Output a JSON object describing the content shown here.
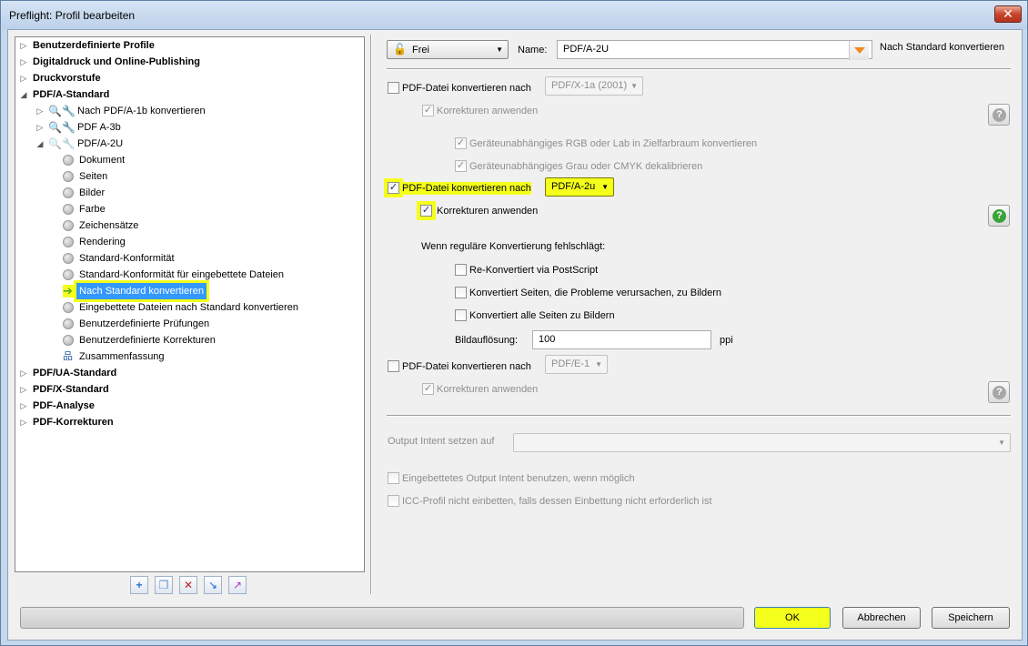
{
  "window": {
    "title": "Preflight: Profil bearbeiten",
    "close_symbol": "✕"
  },
  "tree": {
    "categories_top": [
      "Benutzerdefinierte Profile",
      "Digitaldruck und Online-Publishing",
      "Druckvorstufe",
      "PDF/A-Standard"
    ],
    "profiles": [
      "Nach PDF/A-1b konvertieren",
      "PDF A-3b",
      "PDF/A-2U"
    ],
    "sections": [
      "Dokument",
      "Seiten",
      "Bilder",
      "Farbe",
      "Zeichensätze",
      "Rendering",
      "Standard-Konformität",
      "Standard-Konformität für eingebettete Dateien",
      "Nach Standard konvertieren",
      "Eingebettete Dateien nach Standard konvertieren",
      "Benutzerdefinierte Prüfungen",
      "Benutzerdefinierte Korrekturen",
      "Zusammenfassung"
    ],
    "selected_section": "Nach Standard konvertieren",
    "categories_bottom": [
      "PDF/UA-Standard",
      "PDF/X-Standard",
      "PDF-Analyse",
      "PDF-Korrekturen"
    ],
    "toolbar_icons": [
      "add-icon",
      "duplicate-icon",
      "delete-icon",
      "import-icon",
      "export-icon"
    ]
  },
  "header": {
    "lock_dropdown": "Frei",
    "name_label": "Name:",
    "name_value": "PDF/A-2U",
    "section_title": "Nach Standard konvertieren"
  },
  "pdfx": {
    "label": "PDF-Datei konvertieren nach",
    "dropdown": "PDF/X-1a (2001)",
    "checked": false,
    "corrections": "Korrekturen anwenden",
    "rgb": "Geräteunabhängiges RGB oder Lab in Zielfarbraum konvertieren",
    "gray": "Geräteunabhängiges Grau oder CMYK dekalibrieren"
  },
  "pdfa": {
    "label": "PDF-Datei konvertieren nach",
    "dropdown": "PDF/A-2u",
    "checked": true,
    "corrections": "Korrekturen anwenden",
    "fallback_heading": "Wenn reguläre Konvertierung fehlschlägt:",
    "opt_postscript": "Re-Konvertiert via PostScript",
    "opt_problem_pages": "Konvertiert Seiten, die Probleme verursachen, zu Bildern",
    "opt_all_pages": "Konvertiert alle Seiten zu Bildern",
    "resolution_label": "Bildauflösung:",
    "resolution_value": "100",
    "resolution_unit": "ppi"
  },
  "pdfe": {
    "label": "PDF-Datei konvertieren nach",
    "dropdown": "PDF/E-1",
    "checked": false,
    "corrections": "Korrekturen anwenden"
  },
  "output_intent": {
    "label": "Output Intent setzen auf",
    "embedded": "Eingebettetes Output Intent benutzen, wenn möglich",
    "icc": "ICC-Profil nicht einbetten, falls dessen Einbettung nicht erforderlich ist"
  },
  "buttons": {
    "ok": "OK",
    "cancel": "Abbrechen",
    "save": "Speichern"
  },
  "symbols": {
    "check": "✓",
    "help": "?",
    "caret": "▼",
    "expanded": "◢",
    "collapsed": "▷"
  },
  "colors": {
    "highlight": "#f4ff1b",
    "selection": "#3399ff"
  }
}
